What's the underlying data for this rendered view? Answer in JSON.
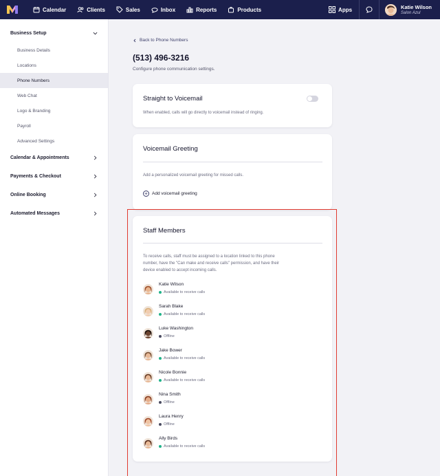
{
  "nav": {
    "items": [
      {
        "label": "Calendar",
        "icon": "calendar-icon"
      },
      {
        "label": "Clients",
        "icon": "clients-icon"
      },
      {
        "label": "Sales",
        "icon": "tag-icon"
      },
      {
        "label": "Inbox",
        "icon": "inbox-icon"
      },
      {
        "label": "Reports",
        "icon": "chart-icon"
      },
      {
        "label": "Products",
        "icon": "bag-icon"
      }
    ],
    "apps_label": "Apps",
    "user_name": "Katie Wilson",
    "user_location": "Salon Azul"
  },
  "sidebar": {
    "business_setup": {
      "label": "Business Setup",
      "items": [
        "Business Details",
        "Locations",
        "Phone Numbers",
        "Web Chat",
        "Logo & Branding",
        "Payroll",
        "Advanced Settings"
      ],
      "active_index": 2
    },
    "sections": [
      "Calendar & Appointments",
      "Payments & Checkout",
      "Online Booking",
      "Automated Messages"
    ]
  },
  "main": {
    "back_label": "Back to Phone Numbers",
    "phone_number": "(513) 496-3216",
    "subtitle": "Configure phone communication settings.",
    "voicemail": {
      "title": "Straight to Voicemail",
      "description": "When enabled, calls will go directly to voicemail instead of ringing.",
      "enabled": false
    },
    "greeting": {
      "title": "Voicemail Greeting",
      "description": "Add a personalized voicemail greeting for missed calls.",
      "add_label": "Add voicemail greeting"
    },
    "staff": {
      "title": "Staff Members",
      "description_lines": [
        "To receive calls, staff must be assigned to a location linked to this phone",
        "number, have the \"Can make and receive calls\" permission, and have their",
        "device enabled to accept incoming calls."
      ],
      "members": [
        {
          "name": "Katie Wilson",
          "status": "Available to receive calls",
          "online": true
        },
        {
          "name": "Sarah Blake",
          "status": "Available to receive calls",
          "online": true
        },
        {
          "name": "Luke Washington",
          "status": "Offline",
          "online": false
        },
        {
          "name": "Jake Bower",
          "status": "Available to receive calls",
          "online": true
        },
        {
          "name": "Nicole Bonnie",
          "status": "Available to receive calls",
          "online": true
        },
        {
          "name": "Nina Smith",
          "status": "Offline",
          "online": false
        },
        {
          "name": "Laura Henry",
          "status": "Offline",
          "online": false
        },
        {
          "name": "Ally Birds",
          "status": "Available to receive calls",
          "online": true
        }
      ]
    }
  },
  "colors": {
    "nav_bg": "#1b1f4c",
    "online": "#21b38a",
    "offline": "#4a4b60",
    "highlight": "#e0392e"
  }
}
